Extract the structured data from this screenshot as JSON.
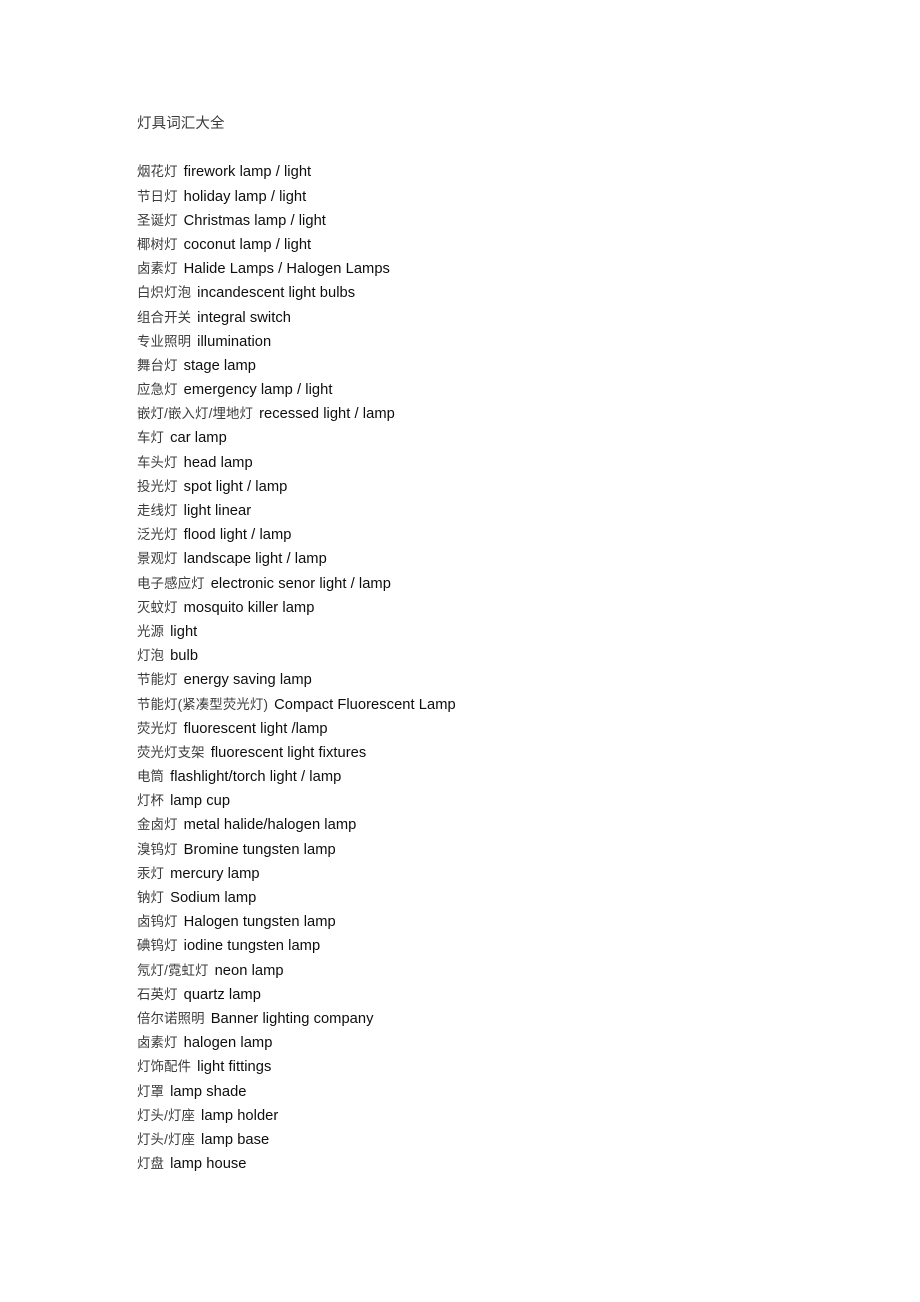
{
  "document": {
    "title": "灯具词汇大全",
    "background_color": "#ffffff",
    "text_color": "#111111",
    "cn_text_color": "#3c3c3c"
  },
  "entries": [
    {
      "cn": "烟花灯",
      "en": "firework lamp / light"
    },
    {
      "cn": "节日灯",
      "en": "holiday lamp / light"
    },
    {
      "cn": "圣诞灯",
      "en": "Christmas lamp / light"
    },
    {
      "cn": "椰树灯",
      "en": "coconut lamp / light"
    },
    {
      "cn": "卤素灯",
      "en": "Halide Lamps / Halogen Lamps"
    },
    {
      "cn": "白炽灯泡",
      "en": "incandescent light bulbs"
    },
    {
      "cn": "组合开关",
      "en": "integral switch"
    },
    {
      "cn": "专业照明",
      "en": "illumination"
    },
    {
      "cn": "舞台灯",
      "en": "stage lamp"
    },
    {
      "cn": "应急灯",
      "en": "emergency lamp / light"
    },
    {
      "cn": "嵌灯/嵌入灯/埋地灯",
      "en": "recessed light / lamp"
    },
    {
      "cn": "车灯",
      "en": "car lamp"
    },
    {
      "cn": "车头灯",
      "en": "head lamp"
    },
    {
      "cn": "投光灯",
      "en": "spot light / lamp"
    },
    {
      "cn": "走线灯",
      "en": "light linear"
    },
    {
      "cn": "泛光灯",
      "en": "flood light / lamp"
    },
    {
      "cn": "景观灯",
      "en": "landscape light / lamp"
    },
    {
      "cn": "电子感应灯",
      "en": "electronic senor light / lamp"
    },
    {
      "cn": "灭蚊灯",
      "en": "mosquito killer lamp"
    },
    {
      "cn": "光源",
      "en": "light"
    },
    {
      "cn": "灯泡",
      "en": "bulb"
    },
    {
      "cn": "节能灯",
      "en": "energy saving lamp"
    },
    {
      "cn": "节能灯(紧凑型荧光灯)",
      "en": "Compact Fluorescent Lamp"
    },
    {
      "cn": "荧光灯",
      "en": "fluorescent light /lamp"
    },
    {
      "cn": "荧光灯支架",
      "en": "fluorescent light fixtures"
    },
    {
      "cn": "电筒",
      "en": "flashlight/torch light / lamp"
    },
    {
      "cn": "灯杯",
      "en": "lamp cup"
    },
    {
      "cn": "金卤灯",
      "en": "metal halide/halogen lamp"
    },
    {
      "cn": "溴钨灯",
      "en": "Bromine tungsten lamp"
    },
    {
      "cn": "汞灯",
      "en": "mercury lamp"
    },
    {
      "cn": "钠灯",
      "en": "Sodium lamp"
    },
    {
      "cn": "卤钨灯",
      "en": "Halogen tungsten lamp"
    },
    {
      "cn": "碘钨灯",
      "en": "iodine tungsten lamp"
    },
    {
      "cn": "氖灯/霓虹灯",
      "en": "neon lamp"
    },
    {
      "cn": "石英灯",
      "en": "quartz lamp"
    },
    {
      "cn": "倍尔诺照明",
      "en": "Banner lighting company"
    },
    {
      "cn": "卤素灯",
      "en": "halogen lamp"
    },
    {
      "cn": "灯饰配件",
      "en": "light fittings"
    },
    {
      "cn": "灯罩",
      "en": "lamp shade"
    },
    {
      "cn": "灯头/灯座",
      "en": "lamp holder"
    },
    {
      "cn": "灯头/灯座",
      "en": "lamp base"
    },
    {
      "cn": "灯盘",
      "en": "lamp house"
    }
  ]
}
